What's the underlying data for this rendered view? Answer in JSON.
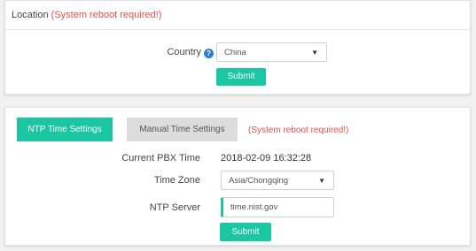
{
  "location": {
    "title": "Location",
    "warning": "(System reboot required!)",
    "country_label": "Country",
    "country_value": "China",
    "submit_label": "Submit"
  },
  "time": {
    "tabs": [
      {
        "label": "NTP Time Settings",
        "active": true
      },
      {
        "label": "Manual Time Settings",
        "active": false
      }
    ],
    "warning": "(System reboot required!)",
    "current_time_label": "Current PBX Time",
    "current_time_value": "2018-02-09 16:32:28",
    "timezone_label": "Time Zone",
    "timezone_value": "Asia/Chongqing",
    "ntp_label": "NTP Server",
    "ntp_value": "time.nist.gov",
    "submit_label": "Submit"
  },
  "colors": {
    "accent": "#1bc6a2",
    "warning": "#e0524b",
    "info": "#2f7fd0"
  },
  "icons": {
    "info": "info-circle-icon",
    "dropdown": "caret-down-icon"
  }
}
